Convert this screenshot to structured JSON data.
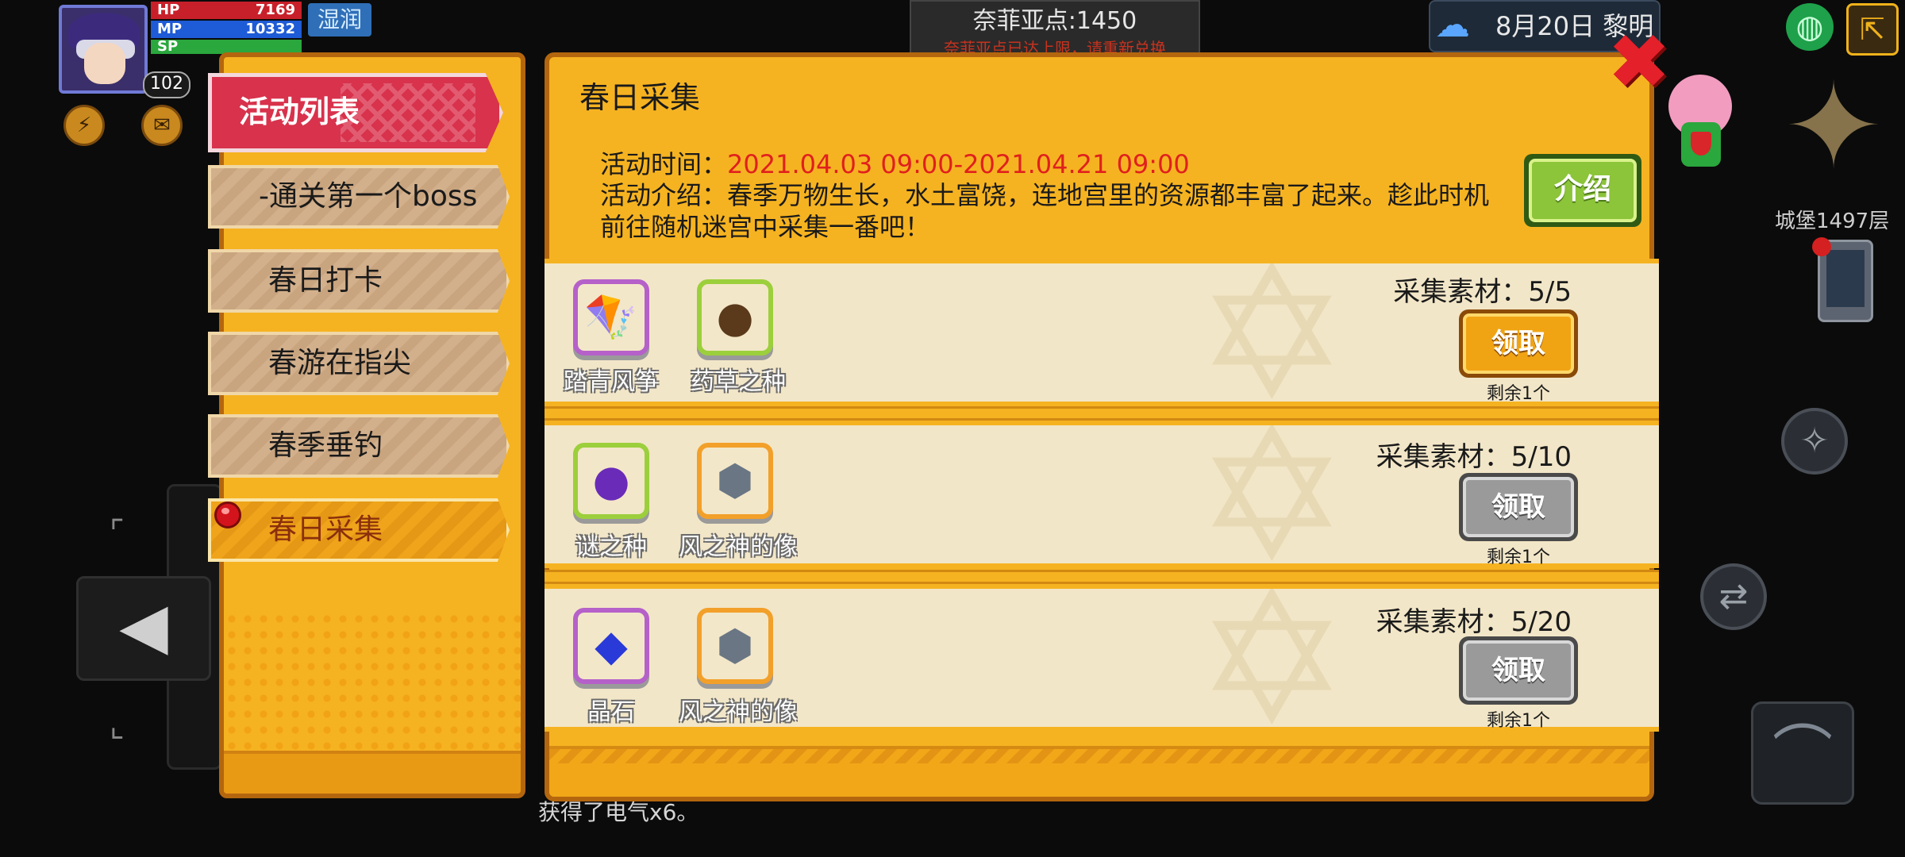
{
  "hud": {
    "hp_label": "HP",
    "hp_value": "7169",
    "mp_label": "MP",
    "mp_value": "10332",
    "sp_label": "SP",
    "sp_value": "",
    "level": "102",
    "status_badge": "湿润",
    "points_text": "奈菲亚点:1450",
    "points_warning": "奈菲亚点已达上限，请重新兑换",
    "date_text": "8月20日  黎明",
    "floor_label": "城堡1497层",
    "log_text": "获得了电气x6。"
  },
  "sidebar": {
    "header": "活动列表",
    "items": [
      {
        "label": "-通关第一个boss"
      },
      {
        "label": "春日打卡"
      },
      {
        "label": "春游在指尖"
      },
      {
        "label": "春季垂钓"
      },
      {
        "label": "春日采集"
      }
    ]
  },
  "main": {
    "title": "春日采集",
    "time_label": "活动时间：",
    "time_value": "2021.04.03 09:00-2021.04.21 09:00",
    "desc_label": "活动介绍：",
    "desc_value": "春季万物生长，水土富饶，连地宫里的资源都丰富了起来。趁此时机前往随机迷宫中采集一番吧！",
    "intro_button": "介绍",
    "rows": [
      {
        "items": [
          {
            "name": "踏青风筝",
            "icon": "kite-icon"
          },
          {
            "name": "药草之种",
            "icon": "herb-seed-icon"
          }
        ],
        "count": "采集素材：5/5",
        "claim": "领取",
        "remain": "剩余1个",
        "state": "available"
      },
      {
        "items": [
          {
            "name": "谜之种",
            "icon": "mystery-seed-icon"
          },
          {
            "name": "风之神的像",
            "icon": "wind-god-statue-icon"
          }
        ],
        "count": "采集素材：5/10",
        "claim": "领取",
        "remain": "剩余1个",
        "state": "disabled"
      },
      {
        "items": [
          {
            "name": "晶石",
            "icon": "crystal-icon"
          },
          {
            "name": "风之神的像",
            "icon": "wind-god-statue-icon"
          }
        ],
        "count": "采集素材：5/20",
        "claim": "领取",
        "remain": "剩余1个",
        "state": "disabled"
      }
    ]
  },
  "colors": {
    "panel": "#f6b321",
    "panel_border": "#b4660e",
    "header_red": "#d8324c",
    "time_red": "#e0201e",
    "claim_gold": "#f0a414",
    "claim_gray": "#9a9a9a"
  }
}
